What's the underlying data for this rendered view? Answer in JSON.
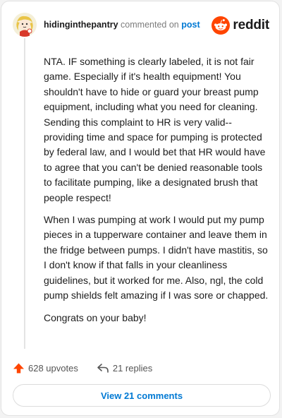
{
  "header": {
    "username": "hidinginthepantry",
    "commented_text": "commented on",
    "post_link": "post",
    "logo_text": "reddit"
  },
  "comment": {
    "paragraphs": [
      "NTA. IF something is clearly labeled, it is not fair game. Especially if it's health equipment! You shouldn't have to hide or guard your breast pump equipment, including what you need for cleaning. Sending this complaint to HR is very valid--providing time and space for pumping is protected by federal law, and I would bet that HR would have to agree that you can't be denied reasonable tools to facilitate pumping, like a designated brush that people respect!",
      "When I was pumping at work I would put my pump pieces in a tupperware container and leave them in the fridge between pumps. I didn't have mastitis, so I don't know if that falls in your cleanliness guidelines, but it worked for me. Also, ngl, the cold pump shields felt amazing if I was sore or chapped.",
      "Congrats on your baby!"
    ]
  },
  "actions": {
    "upvotes": "628 upvotes",
    "replies": "21 replies",
    "upvote_icon": "upvote-arrow-icon",
    "reply_icon": "reply-arrow-icon"
  },
  "footer": {
    "view_comments": "View 21 comments"
  },
  "colors": {
    "brand": "#ff4500",
    "link": "#0079d3",
    "upvote": "#ff4500"
  }
}
